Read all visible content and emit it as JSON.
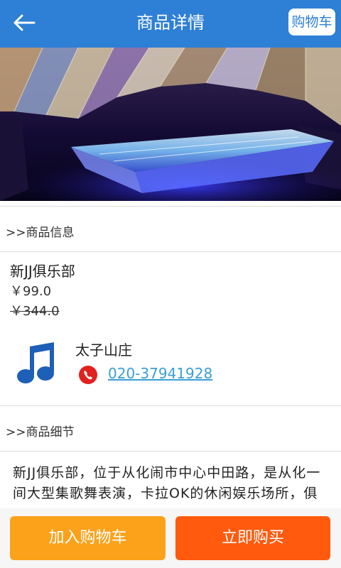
{
  "header": {
    "title": "商品详情",
    "cart_label": "购物车",
    "back_icon": "arrow-left-icon"
  },
  "sections": {
    "info_title": ">>商品信息",
    "detail_title": ">>商品细节"
  },
  "product": {
    "name": "新JJ俱乐部",
    "price": "￥99.0",
    "original_price": "￥344.0"
  },
  "shop": {
    "name": "太子山庄",
    "phone": "020-37941928",
    "logo_icon": "music-note-icon",
    "phone_icon": "phone-icon"
  },
  "detail_text": "新JJ俱乐部，位于从化闹市中心中田路，是从化一间大型集歌舞表演，卡拉OK的休闲娱乐场所，俱乐部设有豪华KTV房、慢摇大厅、动感音乐",
  "actions": {
    "add_to_cart": "加入购物车",
    "buy_now": "立即购买"
  },
  "colors": {
    "header": "#2e7fd6",
    "add_button": "#fba21a",
    "buy_button": "#ff5a0e",
    "link": "#3a9fd6"
  }
}
